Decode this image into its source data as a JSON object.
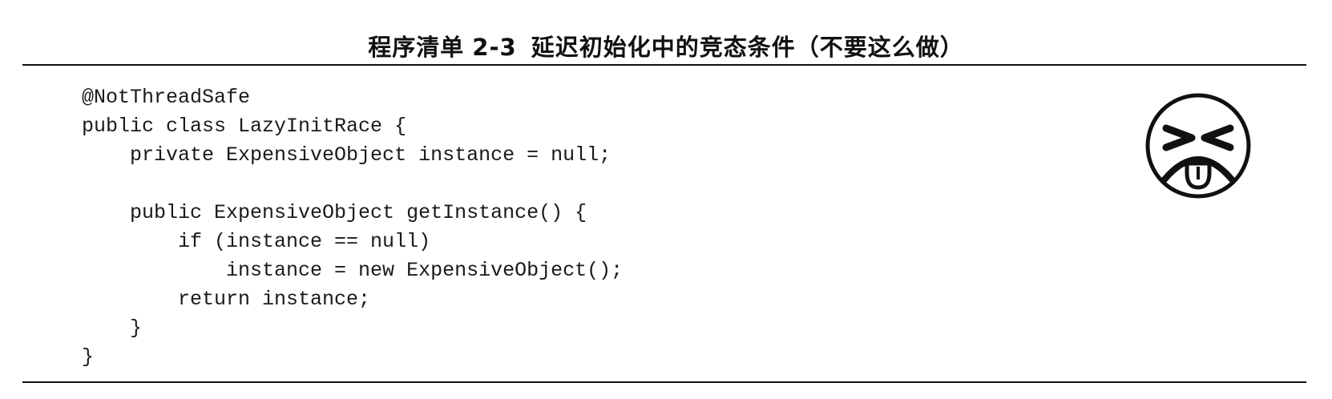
{
  "listing": {
    "label": "程序清单",
    "number": "2-3",
    "title": "延迟初始化中的竞态条件（不要这么做）"
  },
  "code": {
    "lines": [
      "@NotThreadSafe",
      "public class LazyInitRace {",
      "    private ExpensiveObject instance = null;",
      "",
      "    public ExpensiveObject getInstance() {",
      "        if (instance == null)",
      "            instance = new ExpensiveObject();",
      "        return instance;",
      "    }",
      "}"
    ]
  },
  "icon": {
    "name": "bad-practice-face-icon",
    "stroke_color": "#111111"
  }
}
